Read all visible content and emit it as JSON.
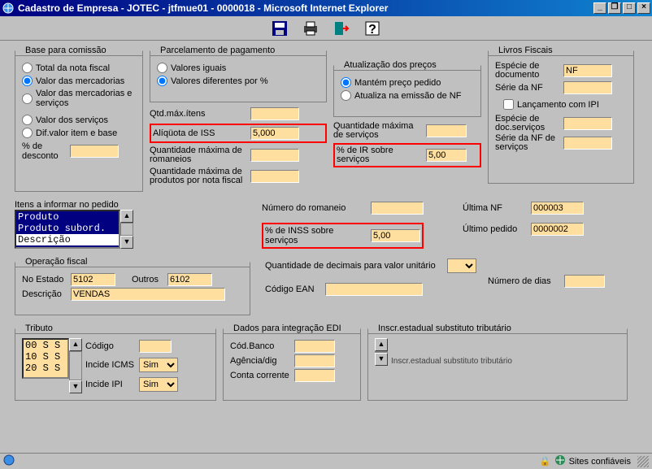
{
  "window": {
    "title": "Cadastro de Empresa - JOTEC - jtfmue01 - 0000018 - Microsoft Internet Explorer",
    "min": "_",
    "max": "□",
    "restore": "❐",
    "close": "×"
  },
  "toolbar_icons": [
    "save",
    "print",
    "exit",
    "help"
  ],
  "base_comissao": {
    "legend": "Base para comissão",
    "opt1": "Total da nota fiscal",
    "opt2": "Valor das mercadorias",
    "opt3": "Valor das mercadorias e serviços",
    "opt4": "Valor dos serviços",
    "opt5": "Dif.valor item e base",
    "pct_desconto_lbl": "% de desconto",
    "pct_desconto": ""
  },
  "parcelamento": {
    "legend": "Parcelamento de pagamento",
    "opt1": "Valores iguais",
    "opt2": "Valores diferentes por %"
  },
  "qtd": {
    "qtd_max_itens_lbl": "Qtd.máx.ítens",
    "qtd_max_itens": "",
    "aliquota_iss_lbl": "Alíqüota de ISS",
    "aliquota_iss": "5,000",
    "qtd_max_rom_lbl": "Quantidade máxima de romaneios",
    "qtd_max_rom": "",
    "qtd_max_prod_lbl": "Quantidade máxima de produtos por nota fiscal",
    "qtd_max_prod": ""
  },
  "atualizacao": {
    "legend": "Atualização dos preços",
    "opt1": "Mantém preço pedido",
    "opt2": "Atualiza na emissão de NF"
  },
  "servicos": {
    "qmax_lbl": "Quantidade máxima de serviços",
    "qmax": "",
    "pir_lbl": "% de IR sobre serviços",
    "pir": "5,00"
  },
  "livros": {
    "legend": "Livros Fiscais",
    "especie_lbl": "Espécie de documento",
    "especie": "NF",
    "serie_nf_lbl": "Série da NF",
    "serie_nf": "",
    "lancamento_ipi": "Lançamento com IPI",
    "especie_doc_serv_lbl": "Espécie de doc.serviços",
    "especie_doc_serv": "",
    "serie_nf_serv_lbl": "Série da NF de serviços",
    "serie_nf_serv": ""
  },
  "itens_pedido": {
    "legend": "Itens a informar no pedido",
    "items": [
      "Produto",
      "Produto subord.",
      "Descrição"
    ]
  },
  "meio": {
    "num_rom_lbl": "Número do romaneio",
    "num_rom": "",
    "inss_lbl": "% de INSS sobre serviços",
    "inss": "5,00",
    "ultima_nf_lbl": "Última NF",
    "ultima_nf": "000003",
    "ultimo_ped_lbl": "Último pedido",
    "ultimo_ped": "0000002"
  },
  "opfiscal": {
    "legend": "Operação fiscal",
    "no_estado_lbl": "No Estado",
    "no_estado": "5102",
    "outros_lbl": "Outros",
    "outros": "6102",
    "descricao_lbl": "Descrição",
    "descricao": "VENDAS"
  },
  "extra": {
    "qdec_lbl": "Quantidade de decimais para valor unitário",
    "codean_lbl": "Código EAN",
    "codean": "",
    "numdias_lbl": "Número de dias",
    "numdias": ""
  },
  "tributo": {
    "legend": "Tributo",
    "list": [
      "00 S S",
      "10 S S",
      "20 S S"
    ],
    "codigo_lbl": "Código",
    "codigo": "",
    "incide_icms_lbl": "Incide ICMS",
    "incide_icms": "Sim",
    "incide_ipi_lbl": "Incide IPI",
    "incide_ipi": "Sim"
  },
  "edi": {
    "legend": "Dados para integração EDI",
    "cod_banco_lbl": "Cód.Banco",
    "cod_banco": "",
    "agencia_lbl": "Agência/dig",
    "agencia": "",
    "conta_lbl": "Conta corrente",
    "conta": ""
  },
  "inscr": {
    "legend": "Inscr.estadual substituto tributário",
    "status_line": "Inscr.estadual substituto tributário"
  },
  "status": {
    "text": "Sites confiáveis"
  }
}
